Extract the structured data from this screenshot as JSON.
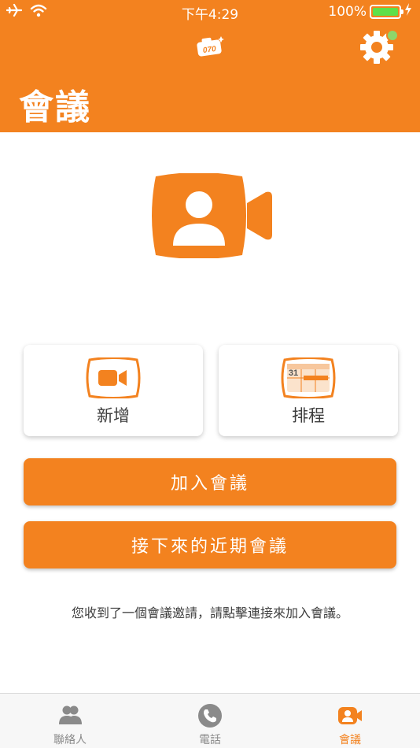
{
  "status_bar": {
    "time": "下午4:29",
    "battery": "100%",
    "icons": [
      "airplane-icon",
      "wifi-icon",
      "battery-icon",
      "charging-icon"
    ]
  },
  "header": {
    "title": "會議",
    "settings_icon": "gear-icon",
    "notification_dot_color": "#8ed66a"
  },
  "actions": {
    "new_label": "新增",
    "schedule_label": "排程",
    "schedule_calendar_day": "31",
    "join_label": "加入會議",
    "upcoming_label": "接下來的近期會議"
  },
  "hint_text": "您收到了一個會議邀請，請點擊連接來加入會議。",
  "tabs": [
    {
      "label": "聯絡人",
      "icon": "contacts-icon",
      "active": false
    },
    {
      "label": "電話",
      "icon": "phone-icon",
      "active": false
    },
    {
      "label": "會議",
      "icon": "meeting-video-icon",
      "active": true
    }
  ],
  "colors": {
    "accent": "#F3821F",
    "tab_inactive": "#8a8a8a"
  }
}
